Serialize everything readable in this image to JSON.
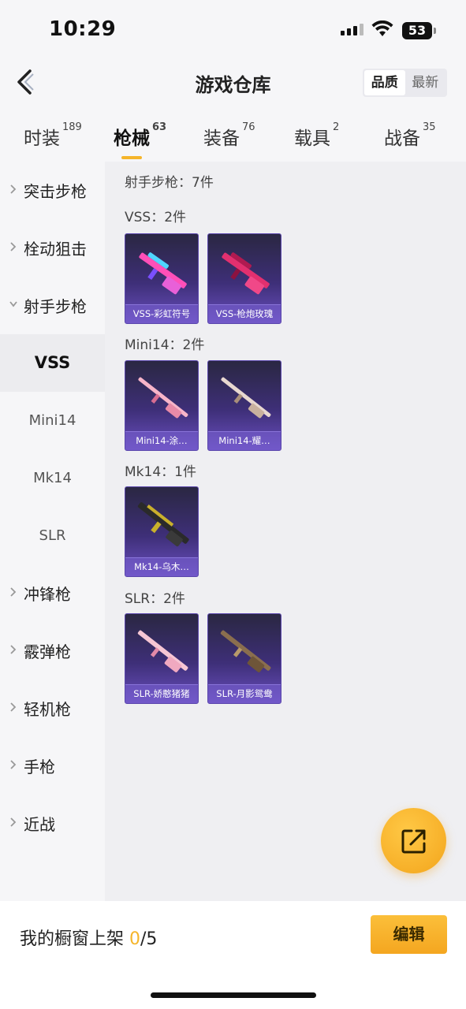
{
  "status": {
    "time": "10:29",
    "battery": "53"
  },
  "header": {
    "title": "游戏仓库",
    "seg": [
      "品质",
      "最新"
    ]
  },
  "tabs": [
    {
      "label": "时装",
      "count": "189"
    },
    {
      "label": "枪械",
      "count": "63"
    },
    {
      "label": "装备",
      "count": "76"
    },
    {
      "label": "载具",
      "count": "2"
    },
    {
      "label": "战备",
      "count": "35"
    }
  ],
  "sidebar": {
    "items": [
      "突击步枪",
      "栓动狙击",
      "射手步枪",
      "冲锋枪",
      "霰弹枪",
      "轻机枪",
      "手枪",
      "近战"
    ],
    "subs": [
      "VSS",
      "Mini14",
      "Mk14",
      "SLR"
    ]
  },
  "main": {
    "category_title": "射手步枪：7件",
    "groups": [
      {
        "title": "VSS：2件",
        "items": [
          "VSS-彩虹符号",
          "VSS-枪炮玫瑰"
        ]
      },
      {
        "title": "Mini14：2件",
        "items": [
          "Mini14-涂…",
          "Mini14-耀…"
        ]
      },
      {
        "title": "Mk14：1件",
        "items": [
          "Mk14-乌木…"
        ]
      },
      {
        "title": "SLR：2件",
        "items": [
          "SLR-娇憨猪猪",
          "SLR-月影鸳鸯"
        ]
      }
    ]
  },
  "bottom": {
    "label": "我的橱窗上架 ",
    "count": "0",
    "total": "/5",
    "edit": "编辑"
  },
  "colors": {
    "accent": "#f5b52a",
    "card_bg": "#3e2f78"
  },
  "icons": {
    "back": "back-arrow-icon",
    "fab": "share-external-icon"
  }
}
